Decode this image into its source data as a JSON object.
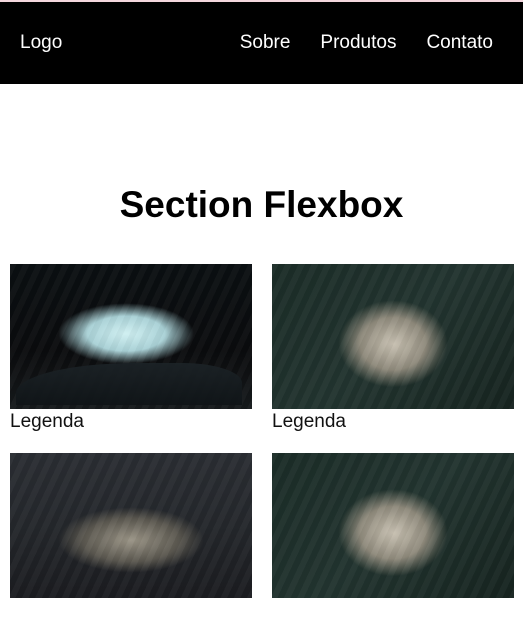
{
  "nav": {
    "logo": "Logo",
    "links": [
      "Sobre",
      "Produtos",
      "Contato"
    ]
  },
  "section": {
    "title": "Section Flexbox",
    "cards": [
      {
        "caption": "Legenda",
        "image": "white-wolf"
      },
      {
        "caption": "Legenda",
        "image": "gray-wolf"
      },
      {
        "caption": "",
        "image": "wolf-pack"
      },
      {
        "caption": "",
        "image": "gray-wolf"
      }
    ]
  }
}
